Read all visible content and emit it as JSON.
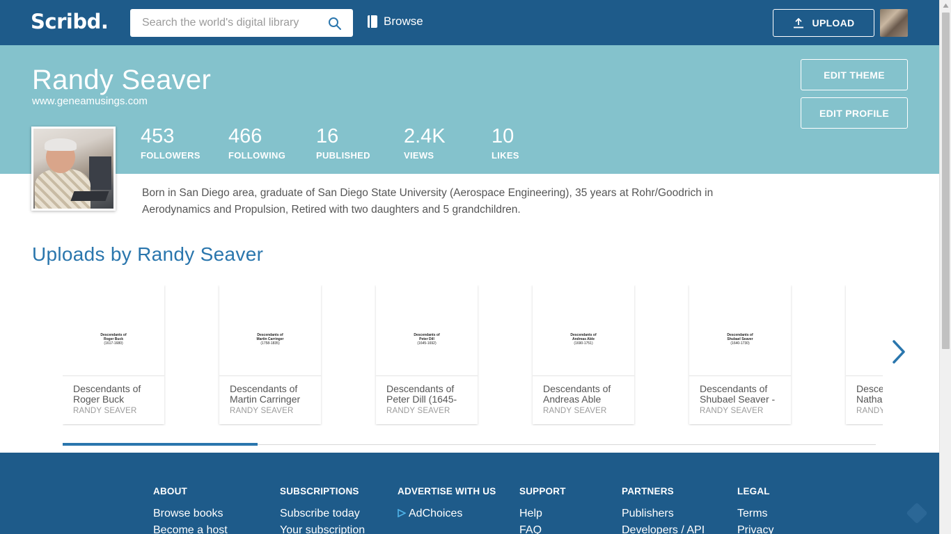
{
  "header": {
    "logo": "Scribd.",
    "search_placeholder": "Search the world's digital library",
    "browse_label": "Browse",
    "upload_label": "UPLOAD"
  },
  "profile": {
    "name": "Randy Seaver",
    "url": "www.geneamusings.com",
    "edit_theme_label": "EDIT THEME",
    "edit_profile_label": "EDIT PROFILE",
    "stats": [
      {
        "value": "453",
        "label": "FOLLOWERS"
      },
      {
        "value": "466",
        "label": "FOLLOWING"
      },
      {
        "value": "16",
        "label": "PUBLISHED"
      },
      {
        "value": "2.4K",
        "label": "VIEWS"
      },
      {
        "value": "10",
        "label": "LIKES"
      }
    ],
    "bio_line1": "Born in San Diego area, graduate of San Diego State University (Aerospace Engineering), 35 years at Rohr/Goodrich in",
    "bio_line2": "Aerodynamics and Propulsion, Retired with two daughters and 5 grandchildren."
  },
  "uploads": {
    "title": "Uploads by Randy Seaver",
    "items": [
      {
        "thumb_line1": "Descendants of",
        "thumb_line2": "Roger Buck",
        "thumb_line3": "(1617-1680)",
        "title_line1": "Descendants of",
        "title_line2": "Roger Buck (1617-",
        "author": "RANDY SEAVER"
      },
      {
        "thumb_line1": "Descendants of",
        "thumb_line2": "Martin Carringer",
        "thumb_line3": "(1758-1835)",
        "title_line1": "Descendants of",
        "title_line2": "Martin Carringer",
        "author": "RANDY SEAVER"
      },
      {
        "thumb_line1": "Descendants of",
        "thumb_line2": "Peter Dill",
        "thumb_line3": "(1645-1692)",
        "title_line1": "Descendants of",
        "title_line2": "Peter Dill (1645-",
        "author": "RANDY SEAVER"
      },
      {
        "thumb_line1": "Descendants of",
        "thumb_line2": "Andreas Able",
        "thumb_line3": "(1690-1751)",
        "title_line1": "Descendants of",
        "title_line2": "Andreas Able",
        "author": "RANDY SEAVER"
      },
      {
        "thumb_line1": "Descendants of",
        "thumb_line2": "Shubael Seaver",
        "thumb_line3": "(1640-1730)",
        "title_line1": "Descendants of",
        "title_line2": "Shubael Seaver -",
        "author": "RANDY SEAVER"
      },
      {
        "thumb_line1": "",
        "thumb_line2": "",
        "thumb_line3": "",
        "title_line1": "Descendants of",
        "title_line2": "Nathaniel",
        "author": "RANDY SEAVER"
      }
    ],
    "progress": 0.24
  },
  "footer": {
    "columns": [
      {
        "heading": "ABOUT",
        "link1": "Browse books",
        "link2": "Become a host"
      },
      {
        "heading": "SUBSCRIPTIONS",
        "link1": "Subscribe today",
        "link2": "Your subscription"
      },
      {
        "heading": "ADVERTISE WITH US",
        "link1": "AdChoices",
        "link2": ""
      },
      {
        "heading": "SUPPORT",
        "link1": "Help",
        "link2": "FAQ"
      },
      {
        "heading": "PARTNERS",
        "link1": "Publishers",
        "link2": "Developers / API"
      },
      {
        "heading": "LEGAL",
        "link1": "Terms",
        "link2": "Privacy"
      }
    ]
  },
  "colors": {
    "header_bg": "#1e5b8a",
    "banner_bg": "#84c2cc",
    "accent": "#2a76ad"
  }
}
